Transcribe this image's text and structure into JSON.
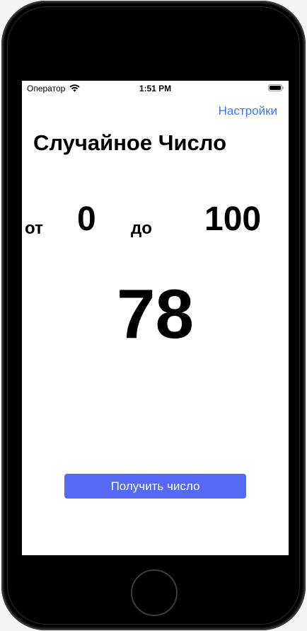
{
  "status_bar": {
    "carrier": "Оператор",
    "time": "1:51 PM",
    "wifi_icon": "wifi-icon",
    "battery_icon": "battery-icon"
  },
  "nav": {
    "settings_label": "Настройки"
  },
  "title": "Случайное Число",
  "range": {
    "from_label": "от",
    "min": "0",
    "to_label": "до",
    "max": "100"
  },
  "result": "78",
  "button": {
    "label": "Получить число"
  },
  "colors": {
    "accent_link": "#3478f6",
    "button_bg": "#5568f6",
    "button_text": "#ffffff",
    "background": "#ffffff",
    "text": "#000000"
  }
}
